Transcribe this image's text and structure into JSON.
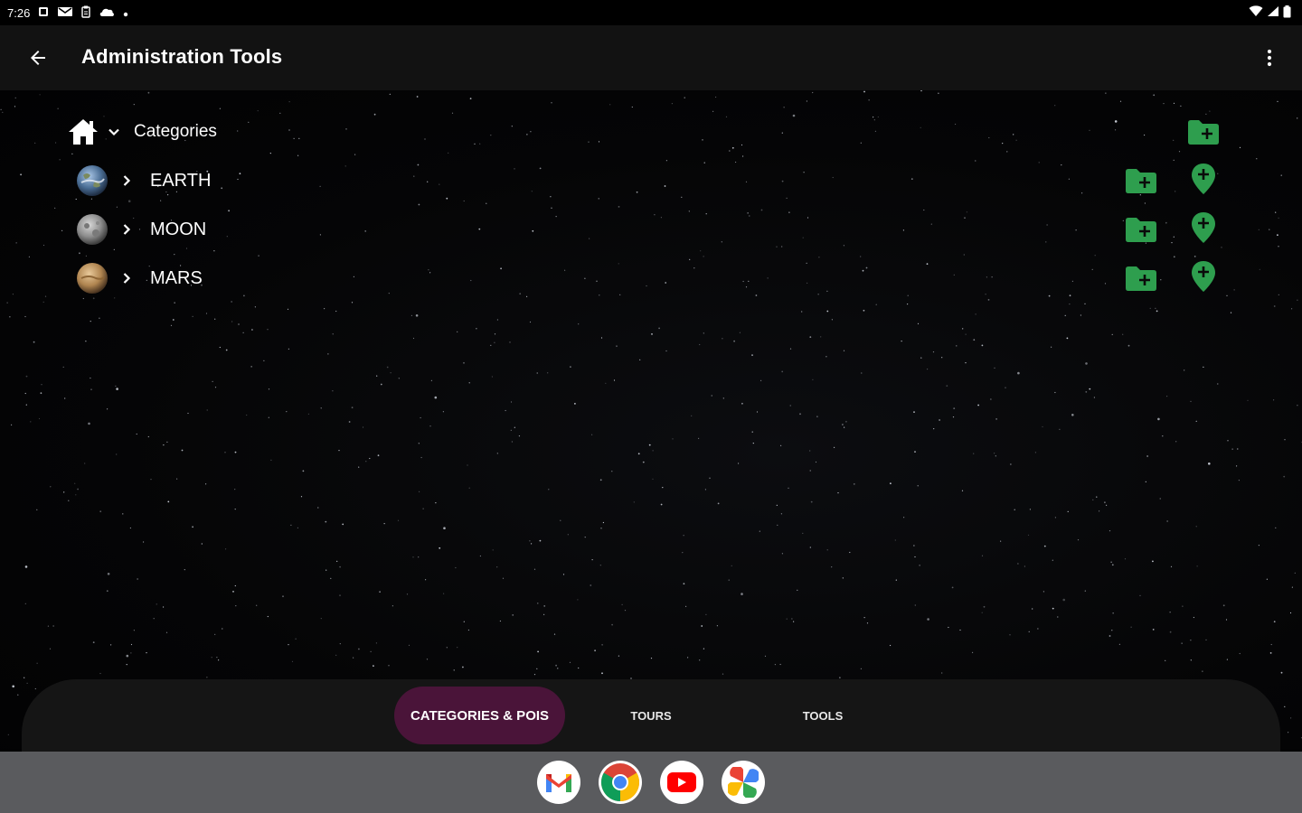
{
  "status_bar": {
    "time": "7:26",
    "left_icons": [
      "notification-icon",
      "gmail-notif-icon",
      "clipboard-icon",
      "cloud-icon",
      "dot-icon"
    ],
    "right_icons": [
      "wifi-icon",
      "signal-icon",
      "battery-icon"
    ]
  },
  "app_bar": {
    "title": "Administration Tools",
    "back_icon": "arrow-left-icon",
    "menu_icon": "more-vert-icon"
  },
  "tree": {
    "root": {
      "label": "Categories",
      "icon": "home-icon",
      "expanded": true
    },
    "children": [
      {
        "label": "EARTH",
        "icon": "earth-planet-icon",
        "color": "#5f7fa8"
      },
      {
        "label": "MOON",
        "icon": "moon-planet-icon",
        "color": "#9a9a9a"
      },
      {
        "label": "MARS",
        "icon": "mars-planet-icon",
        "color": "#b8915c"
      }
    ]
  },
  "actions": {
    "add_category_icon": "create-new-folder-icon",
    "add_poi_icon": "add-location-icon",
    "accent": "#2e9e4e"
  },
  "bottom_nav": {
    "tabs": [
      {
        "label": "CATEGORIES & POIS",
        "active": true
      },
      {
        "label": "TOURS",
        "active": false
      },
      {
        "label": "TOOLS",
        "active": false
      }
    ],
    "active_color": "#4a1439"
  },
  "dock": {
    "apps": [
      "gmail-app-icon",
      "chrome-app-icon",
      "youtube-app-icon",
      "photos-app-icon"
    ]
  }
}
